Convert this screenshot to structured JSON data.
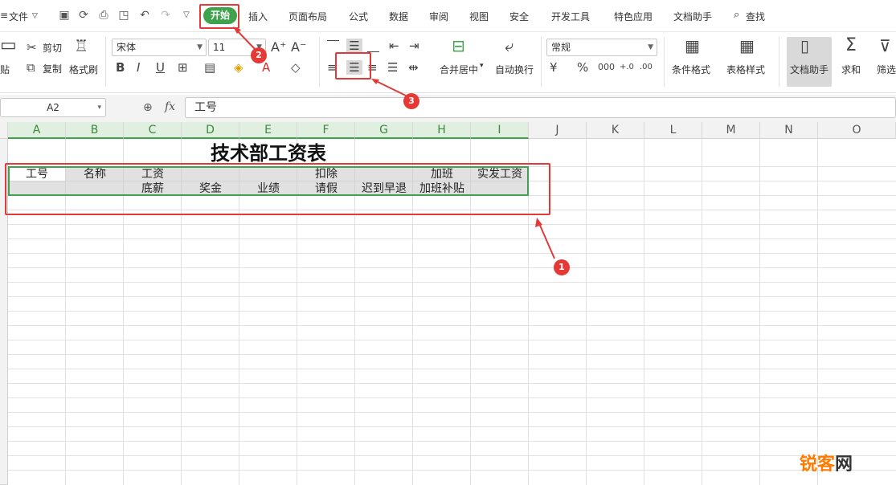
{
  "menu": {
    "file": "文件",
    "tabs": [
      "开始",
      "插入",
      "页面布局",
      "公式",
      "数据",
      "审阅",
      "视图",
      "安全",
      "开发工具",
      "特色应用",
      "文档助手",
      "查找"
    ]
  },
  "ribbon": {
    "paste": "贴",
    "cut": "剪切",
    "copy": "复制",
    "format_painter": "格式刷",
    "font_name": "宋体",
    "font_size": "11",
    "merge_center": "合并居中",
    "wrap_text": "自动换行",
    "number_format": "常规",
    "conditional_format": "条件格式",
    "table_style": "表格样式",
    "doc_assistant": "文档助手",
    "sum": "求和",
    "filter": "筛选"
  },
  "formula_bar": {
    "name_box": "A2",
    "fx": "fx",
    "content": "工号"
  },
  "columns": [
    "A",
    "B",
    "C",
    "D",
    "E",
    "F",
    "G",
    "H",
    "I",
    "J",
    "K",
    "L",
    "M",
    "N",
    "O"
  ],
  "sheet": {
    "title": "技术部工资表",
    "row2": [
      "工号",
      "名称",
      "工资",
      "",
      "",
      "扣除",
      "",
      "加班",
      "实发工资"
    ],
    "row3": [
      "",
      "",
      "底薪",
      "奖金",
      "业绩",
      "请假",
      "迟到早退",
      "加班补贴",
      ""
    ]
  },
  "annotations": {
    "badge1": "1",
    "badge2": "2",
    "badge3": "3"
  },
  "watermark": {
    "a": "锐客",
    "b": "网"
  }
}
